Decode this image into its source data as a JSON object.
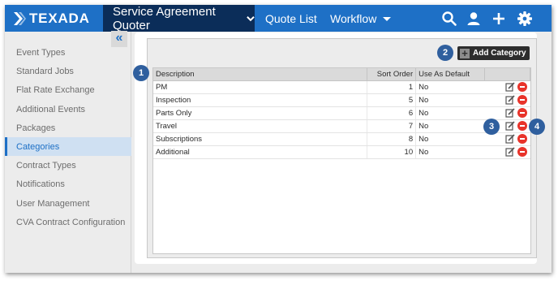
{
  "brand": {
    "name": "TEXADA"
  },
  "nav": {
    "active_label": "Service Agreement Quoter",
    "quote_list_label": "Quote List",
    "workflow_label": "Workflow",
    "icons": [
      "search-icon",
      "user-icon",
      "plus-icon",
      "gear-icon"
    ]
  },
  "sidebar": {
    "collapse_glyph": "«",
    "items": [
      {
        "label": "Event Types"
      },
      {
        "label": "Standard Jobs"
      },
      {
        "label": "Flat Rate Exchange"
      },
      {
        "label": "Additional Events"
      },
      {
        "label": "Packages"
      },
      {
        "label": "Categories",
        "active": true
      },
      {
        "label": "Contract Types"
      },
      {
        "label": "Notifications"
      },
      {
        "label": "User Management"
      },
      {
        "label": "CVA Contract Configuration"
      }
    ]
  },
  "toolbar": {
    "add_category_label": "Add Category"
  },
  "table": {
    "headers": {
      "description": "Description",
      "sort_order": "Sort Order",
      "use_as_default": "Use As Default"
    },
    "rows": [
      {
        "description": "PM",
        "sort_order": "1",
        "default": "No"
      },
      {
        "description": "Inspection",
        "sort_order": "5",
        "default": "No"
      },
      {
        "description": "Parts Only",
        "sort_order": "6",
        "default": "No"
      },
      {
        "description": "Travel",
        "sort_order": "7",
        "default": "No"
      },
      {
        "description": "Subscriptions",
        "sort_order": "8",
        "default": "No"
      },
      {
        "description": "Additional",
        "sort_order": "10",
        "default": "No"
      }
    ]
  },
  "callouts": [
    "1",
    "2",
    "3",
    "4"
  ],
  "colors": {
    "brand_blue": "#1e70c6",
    "active_nav": "#0b2d59",
    "delete_red": "#e8332a",
    "callout": "#2f5f9e"
  }
}
